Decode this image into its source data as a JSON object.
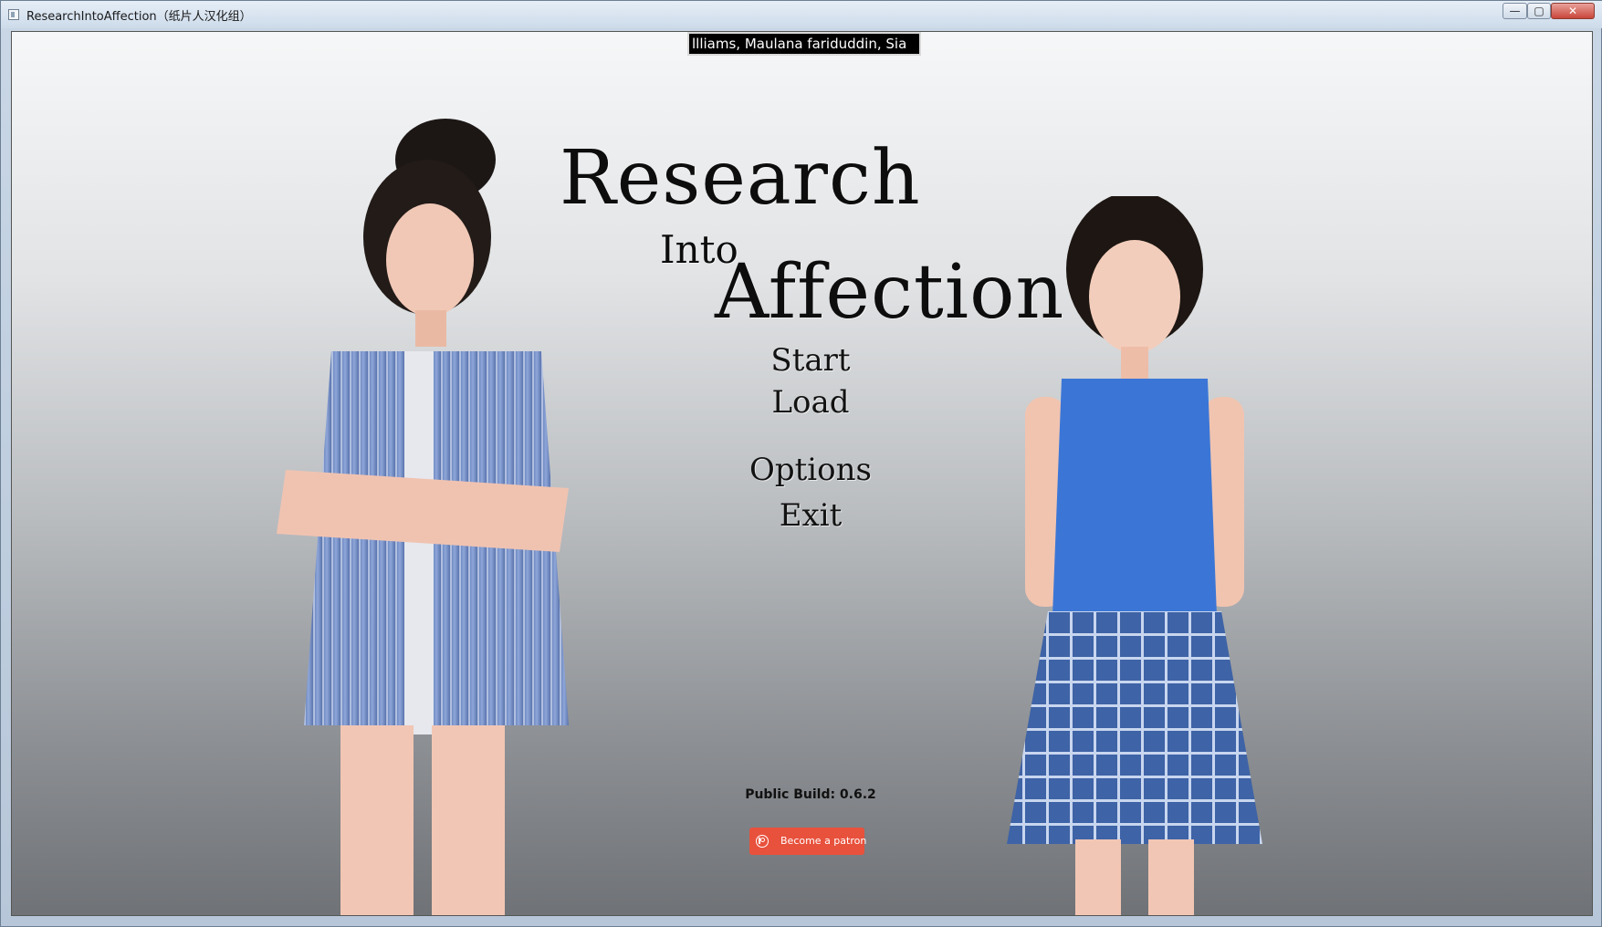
{
  "window": {
    "title": "ResearchIntoAffection（纸片人汉化组）",
    "minimize_glyph": "—",
    "maximize_glyph": "▢",
    "close_glyph": "✕"
  },
  "game": {
    "credits_ticker": "llliams, Maulana fariduddin, Sia",
    "logo": {
      "line1": "Research",
      "line2": "Into",
      "line3": "Affection"
    },
    "menu": {
      "start": "Start",
      "load": "Load",
      "options": "Options",
      "exit": "Exit"
    },
    "build_label": "Public Build: 0.6.2",
    "patron_button": "Become a patron"
  },
  "icons": {
    "app": "app-window-icon",
    "patron": "patreon-logo-icon"
  },
  "colors": {
    "patron_accent": "#e8513c",
    "close_button": "#c9463a",
    "ticker_bg": "#000000"
  }
}
